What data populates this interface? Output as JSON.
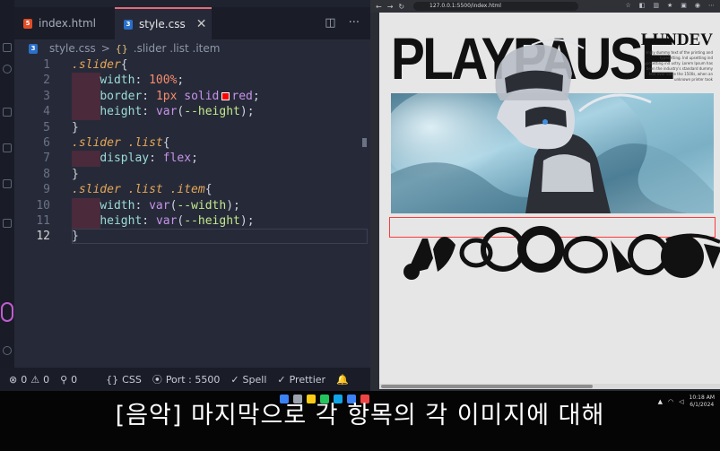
{
  "editor": {
    "tabs": [
      {
        "label": "index.html",
        "icon": "html-file-icon"
      },
      {
        "label": "style.css",
        "icon": "css-file-icon",
        "active": true
      }
    ],
    "breadcrumb": {
      "file": "style.css",
      "separator": ">",
      "symbol": ".slider .list .item"
    },
    "line_numbers": [
      "1",
      "2",
      "3",
      "4",
      "5",
      "6",
      "7",
      "8",
      "9",
      "10",
      "11",
      "12"
    ],
    "current_line": "12",
    "code": {
      "l1_sel": ".slider",
      "l1_brace": "{",
      "l2_prop": "width",
      "l2_val": "100%",
      "l3_prop": "border",
      "l3_num": "1px",
      "l3_kw": "solid",
      "l3_color": "red",
      "l4_prop": "height",
      "l4_fn": "var",
      "l4_var": "--height",
      "l5": "}",
      "l6_sel": ".slider .list",
      "l6_brace": "{",
      "l7_prop": "display",
      "l7_val": "flex",
      "l8": "}",
      "l9_sel": ".slider .list .item",
      "l9_brace": "{",
      "l10_prop": "width",
      "l10_fn": "var",
      "l10_var": "--width",
      "l11_prop": "height",
      "l11_fn": "var",
      "l11_var": "--height",
      "l12": "}"
    },
    "status": {
      "problems": "0",
      "warnings": "0",
      "info": "0",
      "language": "CSS",
      "port": "Port : 5500",
      "spell": "Spell",
      "prettier": "Prettier"
    }
  },
  "browser": {
    "url": "127.0.0.1:5500/index.html",
    "hero_title": "PLAYPAUSE",
    "brand": "LUNDEV",
    "blurb": "imply dummy text of the printing and typesetting. Ind upsetting ind ypesetting ind ustry. Lorem Ipsum has been the industry's standard dummy text ever Since the 1500s, when an unknown printer took"
  },
  "subtitle": "[음악] 마지막으로 각 항목의 각 이미지에 대해",
  "clock": {
    "time": "10:18 AM",
    "date": "6/1/2024"
  },
  "colors": {
    "accent_tab": "#e06c75",
    "slider_border": "#ff3b3b",
    "editor_bg": "#262a38"
  }
}
